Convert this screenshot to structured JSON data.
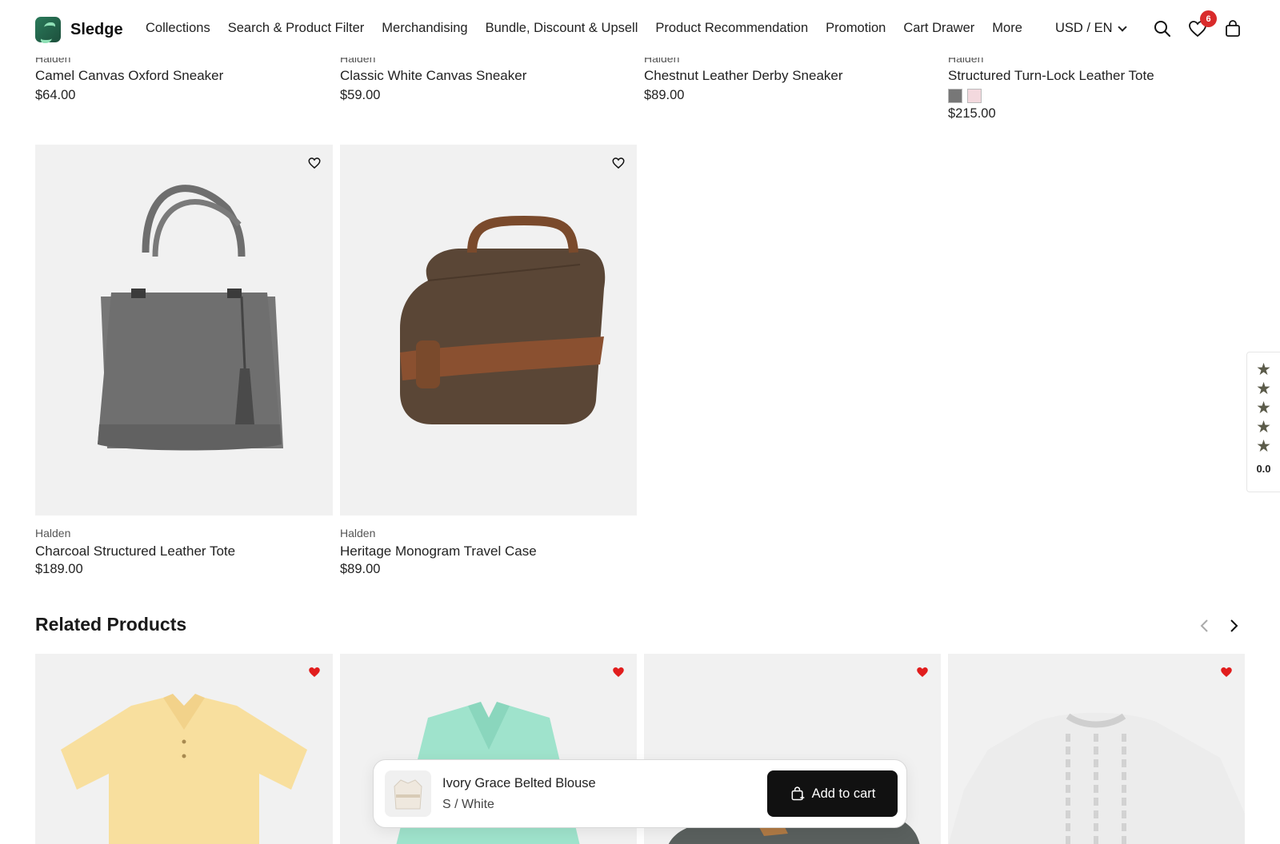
{
  "header": {
    "brand": "Sledge",
    "nav": [
      "Collections",
      "Search & Product Filter",
      "Merchandising",
      "Bundle, Discount & Upsell",
      "Product Recommendation",
      "Promotion",
      "Cart Drawer",
      "More"
    ],
    "currency": "USD / EN",
    "wishlist_count": "6"
  },
  "top_row": [
    {
      "brand": "Halden",
      "name": "Camel Canvas Oxford Sneaker",
      "price": "$64.00"
    },
    {
      "brand": "Halden",
      "name": "Classic White Canvas Sneaker",
      "price": "$59.00"
    },
    {
      "brand": "Halden",
      "name": "Chestnut Leather Derby Sneaker",
      "price": "$89.00"
    },
    {
      "brand": "Halden",
      "name": "Structured Turn-Lock Leather Tote",
      "price": "$215.00",
      "swatches": [
        "#777777",
        "#f3d9de"
      ]
    }
  ],
  "grid": [
    {
      "brand": "Halden",
      "name": "Charcoal Structured Leather Tote",
      "price": "$189.00",
      "image": "charcoal-tote-image"
    },
    {
      "brand": "Halden",
      "name": "Heritage Monogram Travel Case",
      "price": "$89.00",
      "image": "travel-case-image"
    }
  ],
  "related": {
    "title": "Related Products",
    "items": [
      {
        "image": "yellow-polo-image"
      },
      {
        "image": "mint-shirt-dress-image"
      },
      {
        "image": "grey-boot-image"
      },
      {
        "image": "cable-knit-sweater-image"
      }
    ]
  },
  "rating": {
    "score": "0.0",
    "stars": 5
  },
  "sticky": {
    "name": "Ivory Grace Belted Blouse",
    "variant": "S / White",
    "button": "Add to cart"
  }
}
